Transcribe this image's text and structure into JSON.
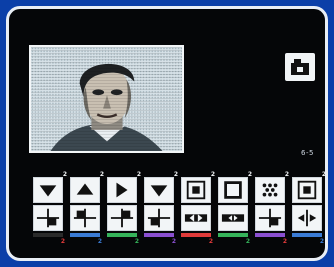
{
  "colors": {
    "frame": "#0b3fa8",
    "screen": "#050608",
    "tile": "#f2f5f7",
    "accent_red": "#e03a3a",
    "accent_blue": "#3a7bd5",
    "accent_green": "#35b35a",
    "accent_purple": "#8a4fd0"
  },
  "photo": {
    "icon": "portrait-image"
  },
  "camera": {
    "icon": "camera-icon"
  },
  "counter": "6-5",
  "tiles": [
    {
      "num": "2",
      "icon_top": "arrow-down-icon",
      "icon_bottom": "split-quadrant-icon",
      "bar": "#2a2a2a",
      "tag": "2",
      "tag_color": "#e03a3a"
    },
    {
      "num": "2",
      "icon_top": "arrow-up-icon",
      "icon_bottom": "split-quadrant-icon",
      "bar": "#3a7bd5",
      "tag": "2",
      "tag_color": "#3a7bd5"
    },
    {
      "num": "2",
      "icon_top": "arrow-right-icon",
      "icon_bottom": "split-quadrant-icon",
      "bar": "#35b35a",
      "tag": "2",
      "tag_color": "#35b35a"
    },
    {
      "num": "2",
      "icon_top": "arrow-down-icon",
      "icon_bottom": "split-quadrant-icon",
      "bar": "#8a4fd0",
      "tag": "2",
      "tag_color": "#8a4fd0"
    },
    {
      "num": "2",
      "icon_top": "square-target-icon",
      "icon_bottom": "arrows-inward-icon",
      "bar": "#e03a3a",
      "tag": "2",
      "tag_color": "#e03a3a"
    },
    {
      "num": "2",
      "icon_top": "square-icon",
      "icon_bottom": "arrows-inward-icon",
      "bar": "#35b35a",
      "tag": "2",
      "tag_color": "#35b35a"
    },
    {
      "num": "2",
      "icon_top": "checker-icon",
      "icon_bottom": "split-quadrant-icon",
      "bar": "#8a4fd0",
      "tag": "2",
      "tag_color": "#e03a3a"
    },
    {
      "num": "2",
      "icon_top": "square-target-icon",
      "icon_bottom": "arrows-inward-icon",
      "bar": "#3a7bd5",
      "tag": "2",
      "tag_color": "#3a7bd5"
    }
  ]
}
